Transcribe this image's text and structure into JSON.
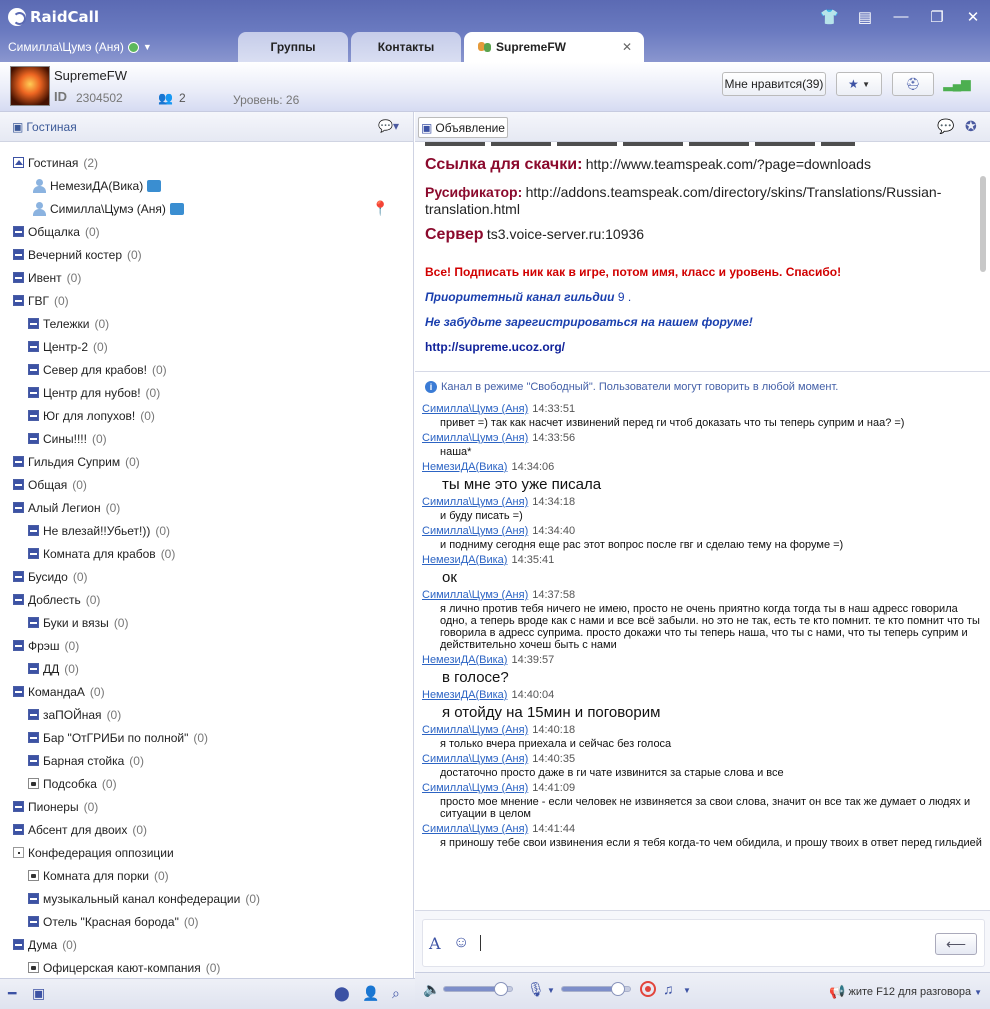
{
  "app": {
    "name": "RaidCall",
    "user_status_name": "Симилла\\Цумэ (Аня)"
  },
  "tabs": [
    {
      "label": "Группы"
    },
    {
      "label": "Контакты"
    },
    {
      "label": "SupremeFW",
      "active": true
    }
  ],
  "channel": {
    "name": "SupremeFW",
    "id_label": "ID",
    "id": "2304502",
    "user_count": "2",
    "level": "Уровень: 26",
    "like_button": "Мне нравится(39)"
  },
  "left": {
    "header": "Гостиная",
    "tree": [
      {
        "label": "Гостиная",
        "count": "(2)",
        "indent": 0,
        "icon": "home"
      },
      {
        "label": "НемезиДА(Вика)",
        "indent": 1,
        "type": "user"
      },
      {
        "label": "Симилла\\Цумэ (Аня)",
        "indent": 1,
        "type": "user",
        "pin": true
      },
      {
        "label": "Общалка",
        "count": "(0)",
        "indent": 0
      },
      {
        "label": "Вечерний костер",
        "count": "(0)",
        "indent": 0
      },
      {
        "label": "Ивент",
        "count": "(0)",
        "indent": 0
      },
      {
        "label": "ГВГ",
        "count": "(0)",
        "indent": 0
      },
      {
        "label": "Тележки",
        "count": "(0)",
        "indent": 1
      },
      {
        "label": "Центр-2",
        "count": "(0)",
        "indent": 1
      },
      {
        "label": "Север для крабов!",
        "count": "(0)",
        "indent": 1
      },
      {
        "label": "Центр для нубов!",
        "count": "(0)",
        "indent": 1
      },
      {
        "label": "Юг для лопухов!",
        "count": "(0)",
        "indent": 1
      },
      {
        "label": "Сины!!!!",
        "count": "(0)",
        "indent": 1
      },
      {
        "label": "Гильдия Суприм",
        "count": "(0)",
        "indent": 0
      },
      {
        "label": "Общая",
        "count": "(0)",
        "indent": 0
      },
      {
        "label": "Алый Легион",
        "count": "(0)",
        "indent": 0
      },
      {
        "label": "Не влезай!!Убьет!))",
        "count": "(0)",
        "indent": 1
      },
      {
        "label": "Комната для крабов",
        "count": "(0)",
        "indent": 1
      },
      {
        "label": "Бусидо",
        "count": "(0)",
        "indent": 0
      },
      {
        "label": "Доблесть",
        "count": "(0)",
        "indent": 0
      },
      {
        "label": "Буки и вязы",
        "count": "(0)",
        "indent": 1
      },
      {
        "label": "Фрэш",
        "count": "(0)",
        "indent": 0
      },
      {
        "label": "ДД",
        "count": "(0)",
        "indent": 1
      },
      {
        "label": "КомандаА",
        "count": "(0)",
        "indent": 0
      },
      {
        "label": "заПОЙная",
        "count": "(0)",
        "indent": 1
      },
      {
        "label": "Бар \"ОтГРИБи по полной\"",
        "count": "(0)",
        "indent": 1
      },
      {
        "label": "Барная стойка",
        "count": "(0)",
        "indent": 1
      },
      {
        "label": "Подсобка",
        "count": "(0)",
        "indent": 1,
        "icon": "lock"
      },
      {
        "label": "Пионеры",
        "count": "(0)",
        "indent": 0
      },
      {
        "label": "Абсент для двоих",
        "count": "(0)",
        "indent": 0
      },
      {
        "label": "Конфедерация оппозиции",
        "count": "",
        "indent": 0,
        "icon": "dot"
      },
      {
        "label": "Комната для порки",
        "count": "(0)",
        "indent": 1,
        "icon": "lock"
      },
      {
        "label": "музыкальный канал конфедерации",
        "count": "(0)",
        "indent": 1
      },
      {
        "label": "Отель \"Красная борода\"",
        "count": "(0)",
        "indent": 1
      },
      {
        "label": "Дума",
        "count": "(0)",
        "indent": 0
      },
      {
        "label": "Офицерская кают-компания",
        "count": "(0)",
        "indent": 1,
        "icon": "lock"
      }
    ]
  },
  "announcement": {
    "button": "Объявление",
    "link_label": "Ссылка для скачки:",
    "link_url": "http://www.teamspeak.com/?page=downloads",
    "rus_label": "Русификатор:",
    "rus_url_1": "http://addons.teamspeak.com/directory/skins/Translations/Russian-",
    "rus_url_2": "translation.html",
    "server_label": "Сервер",
    "server_value": "ts3.voice-server.ru:10936",
    "notice": "Все! Подписать ник как в игре, потом имя, класс и уровень. Спасибо!",
    "priority_label": "Приоритетный канал гильдии",
    "priority_value": "9 .",
    "forum_note": "Не забудьте зарегистрироваться на нашем форуме!",
    "forum_url": "http://supreme.ucoz.org/"
  },
  "chat": {
    "info": "Канал в режиме \"Свободный\". Пользователи могут говорить в любой момент.",
    "messages": [
      {
        "name": "Симилла\\Цумэ (Аня)",
        "time": "14:33:51",
        "text": "привет =) так как насчет извинений перед ги чтоб доказать что ты теперь суприм и наа? =)"
      },
      {
        "name": "Симилла\\Цумэ (Аня)",
        "time": "14:33:56",
        "text": "наша*"
      },
      {
        "name": "НемезиДА(Вика)",
        "time": "14:34:06",
        "text": "ты мне это уже писала",
        "large": true
      },
      {
        "name": "Симилла\\Цумэ (Аня)",
        "time": "14:34:18",
        "text": "и буду писать =)"
      },
      {
        "name": "Симилла\\Цумэ (Аня)",
        "time": "14:34:40",
        "text": "и подниму сегодня еще рас этот вопрос после гвг и сделаю тему на форуме =)"
      },
      {
        "name": "НемезиДА(Вика)",
        "time": "14:35:41",
        "text": "ок",
        "large": true
      },
      {
        "name": "Симилла\\Цумэ (Аня)",
        "time": "14:37:58",
        "text": "я лично против тебя ничего не имею, просто не очень приятно когда тогда ты в наш адресс говорила одно, а теперь вроде как с нами и все всё забыли. но это не так, есть те кто помнит. те кто помнит что ты говорила в адресс суприма. просто докажи что ты теперь наша, что ты с нами, что ты теперь суприм и действительно хочеш быть с нами"
      },
      {
        "name": "НемезиДА(Вика)",
        "time": "14:39:57",
        "text": "в голосе?",
        "large": true
      },
      {
        "name": "НемезиДА(Вика)",
        "time": "14:40:04",
        "text": "я отойду на 15мин и поговорим",
        "large": true
      },
      {
        "name": "Симилла\\Цумэ (Аня)",
        "time": "14:40:18",
        "text": "я только вчера приехала и сейчас без голоса"
      },
      {
        "name": "Симилла\\Цумэ (Аня)",
        "time": "14:40:35",
        "text": "достаточно просто даже в ги чате извинится за старые слова и все"
      },
      {
        "name": "Симилла\\Цумэ (Аня)",
        "time": "14:41:09",
        "text": "просто мое мнение - если человек не извиняется за свои слова, значит  он все так же думает о людях и ситуации в целом"
      },
      {
        "name": "Симилла\\Цумэ (Аня)",
        "time": "14:41:44",
        "text": "я приношу тебе свои извинения если я тебя когда-то чем обидила, и прошу твоих в ответ перед гильдией"
      }
    ]
  },
  "audio": {
    "volume_level": 0.82,
    "mic_level": 0.8,
    "ptt_text": "жите F12 для разговора"
  },
  "colors": {
    "accent": "#3c52a4",
    "titlebar": "#5b6ab3",
    "announce_red": "#8b0a2d",
    "link_blue": "#2c64c4"
  }
}
